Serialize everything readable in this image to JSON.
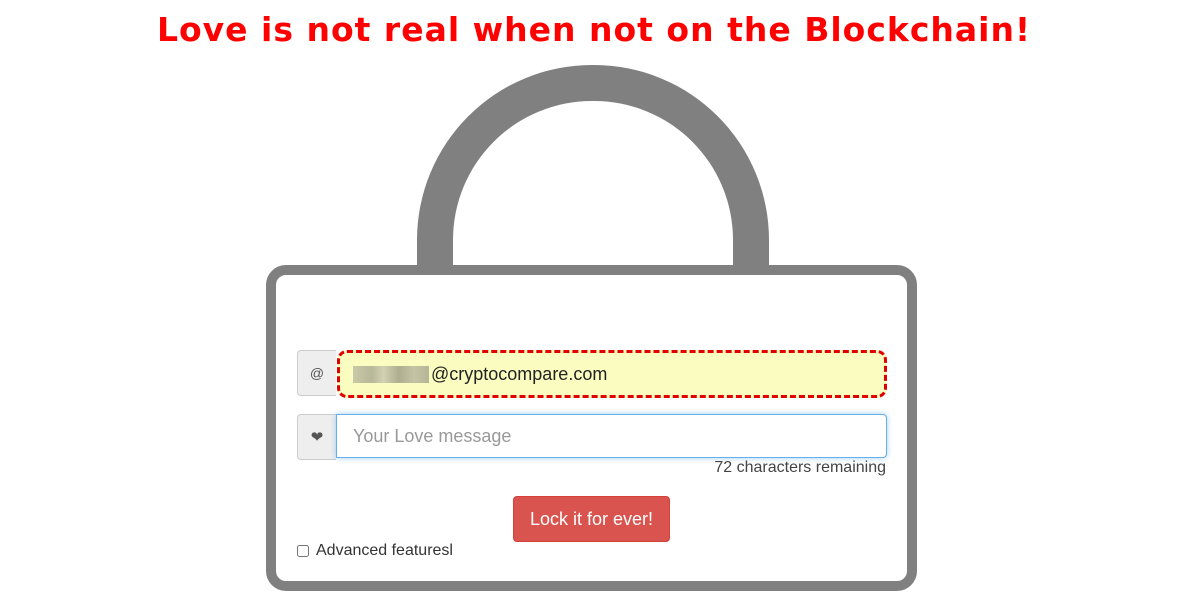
{
  "header": {
    "headline": "Love is not real when not on the Blockchain!"
  },
  "form": {
    "email_addon_symbol": "@",
    "email_value_suffix": "@cryptocompare.com",
    "message_placeholder": "Your Love message",
    "message_value": "",
    "characters_remaining": "72 characters remaining",
    "submit_label": "Lock it for ever!",
    "advanced_label": "Advanced featuresl"
  },
  "icons": {
    "email_addon": "at-icon",
    "message_addon": "heart-icon"
  },
  "colors": {
    "headline": "#ff0000",
    "lock_frame": "#808080",
    "button": "#d9534f",
    "email_highlight": "#fafcc0",
    "email_dash": "#e00000"
  }
}
